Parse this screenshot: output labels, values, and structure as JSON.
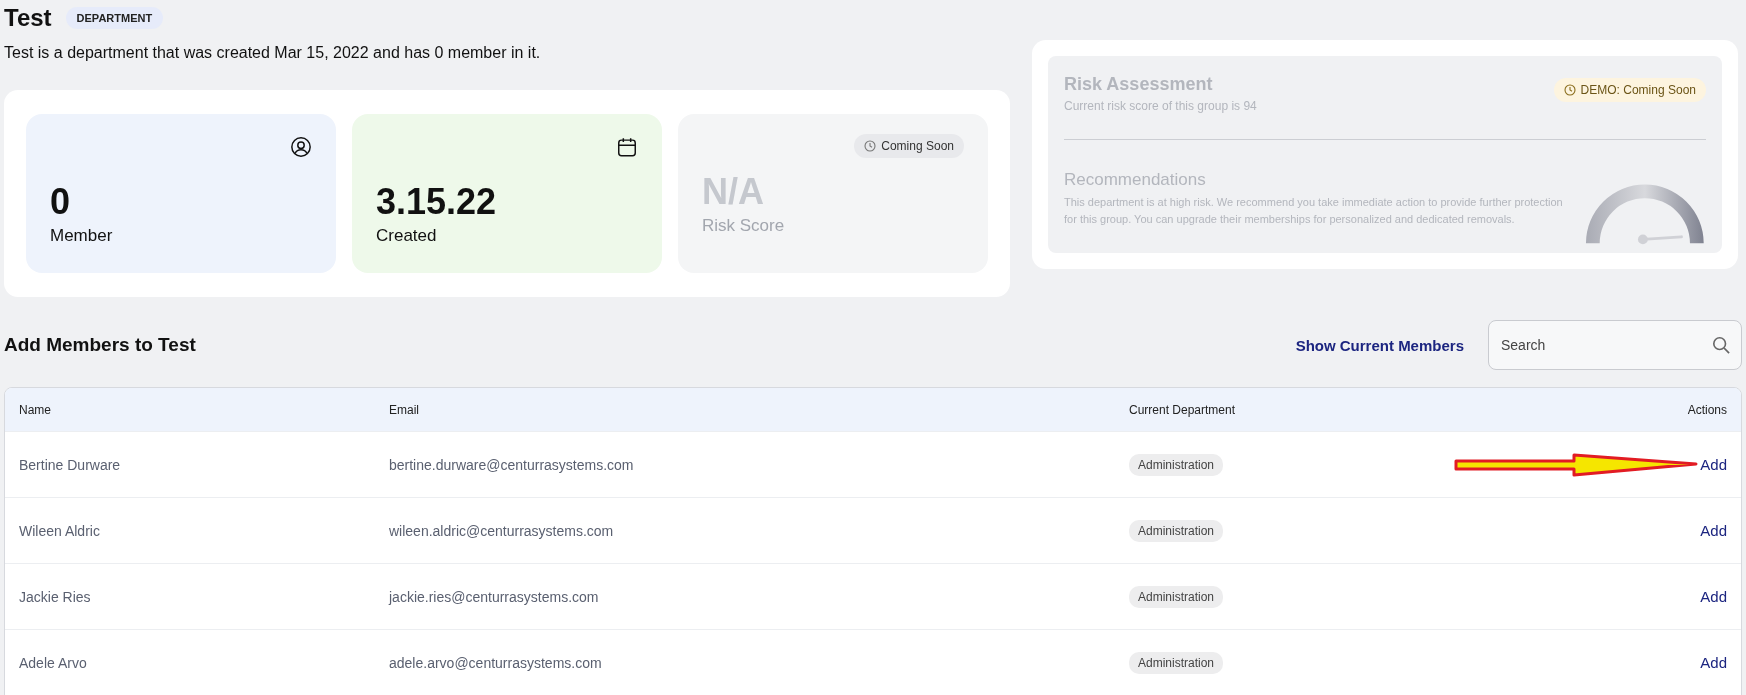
{
  "header": {
    "title": "Test",
    "badge": "DEPARTMENT",
    "description": "Test is a department that was created Mar 15, 2022 and has 0 member in it."
  },
  "stats": [
    {
      "kind": "members",
      "value": "0",
      "label": "Member"
    },
    {
      "kind": "created",
      "value": "3.15.22",
      "label": "Created"
    },
    {
      "kind": "risk",
      "value": "N/A",
      "label": "Risk Score",
      "badge": "Coming Soon",
      "disabled": true
    }
  ],
  "risk_panel": {
    "title": "Risk Assessment",
    "subtitle": "Current risk score of this group is 94",
    "badge": "DEMO: Coming Soon",
    "recommendations_title": "Recommendations",
    "recommendations_text": "This department is at high risk. We recommend you take immediate action to provide further protection for this group. You can upgrade their memberships for personalized and dedicated removals.",
    "level": 0.94
  },
  "members_section": {
    "title": "Add Members to Test",
    "link": "Show Current Members",
    "search": {
      "placeholder": "Search"
    }
  },
  "table": {
    "columns": [
      "Name",
      "Email",
      "Current Department",
      "Actions"
    ],
    "rows": [
      {
        "name": "Bertine Durware",
        "email": "bertine.durware@centurrasystems.com",
        "department": "Administration",
        "action": "Add",
        "annotated": true
      },
      {
        "name": "Wileen Aldric",
        "email": "wileen.aldric@centurrasystems.com",
        "department": "Administration",
        "action": "Add",
        "annotated": false
      },
      {
        "name": "Jackie Ries",
        "email": "jackie.ries@centurrasystems.com",
        "department": "Administration",
        "action": "Add",
        "annotated": false
      },
      {
        "name": "Adele Arvo",
        "email": "adele.arvo@centurrasystems.com",
        "department": "Administration",
        "action": "Add",
        "annotated": false
      }
    ]
  }
}
